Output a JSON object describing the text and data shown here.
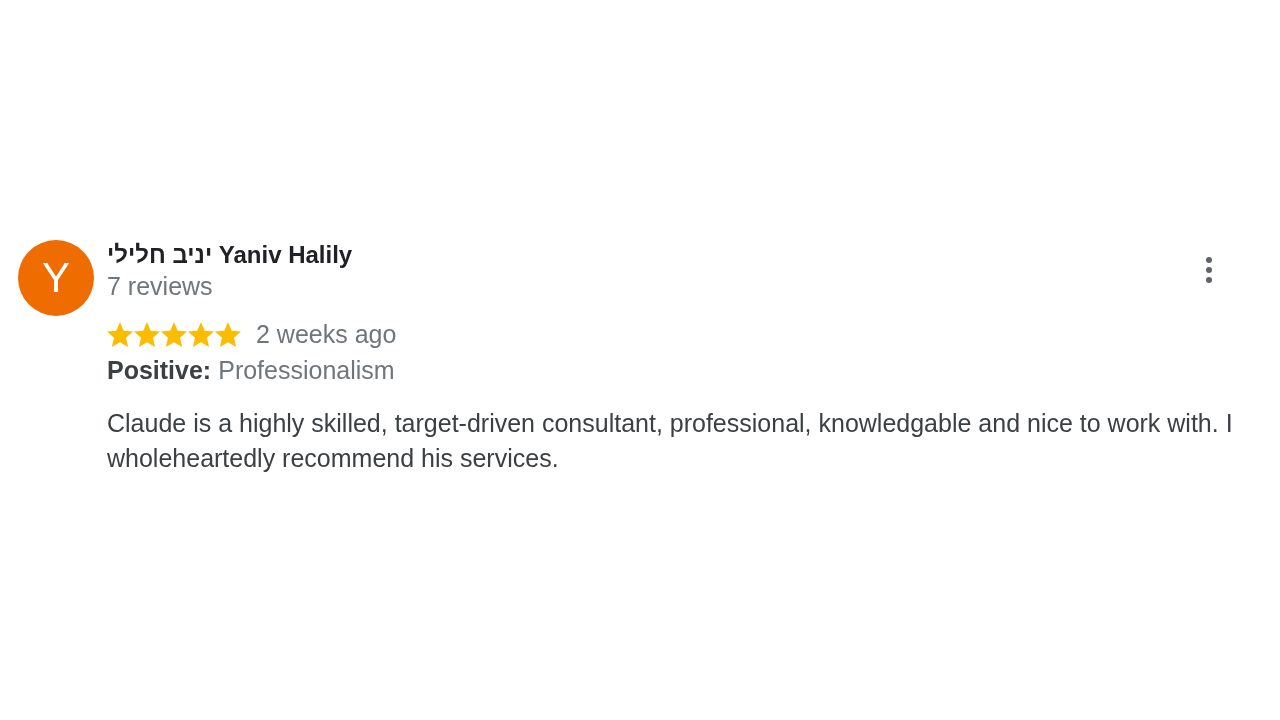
{
  "review": {
    "avatar_initial": "Y",
    "author": "יניב חלילי Yaniv Halily",
    "review_count": "7 reviews",
    "stars": 5,
    "time": "2 weeks ago",
    "highlights": [
      {
        "label": "Positive:",
        "value": "Professionalism"
      }
    ],
    "text": "Claude is a highly skilled, target-driven consultant, professional, knowledgable and nice to work with. I wholeheartedly recommend his services."
  }
}
